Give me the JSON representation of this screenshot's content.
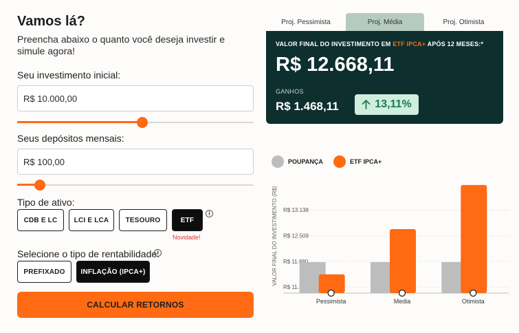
{
  "form": {
    "title": "Vamos lá?",
    "subtitle": "Preencha abaixo o quanto você deseja investir e simule agora!",
    "initial": {
      "label": "Seu investimento inicial:",
      "value": "R$ 10.000,00",
      "slider_fraction": 0.53
    },
    "monthly": {
      "label": "Seus depósitos mensais:",
      "value": "R$ 100,00",
      "slider_fraction": 0.095
    },
    "asset_type": {
      "label": "Tipo de ativo:",
      "options": [
        "CDB E LC",
        "LCI E LCA",
        "TESOURO",
        "ETF"
      ],
      "selected": "ETF",
      "new_tag": "Novidade!",
      "info_icon": "info-icon"
    },
    "rentabilidade": {
      "label": "Selecione o tipo de rentabilidade:",
      "options": [
        "PREFIXADO",
        "INFLAÇÃO (IPCA+)"
      ],
      "selected": "INFLAÇÃO (IPCA+)",
      "info_icon": "info-icon"
    },
    "calculate_label": "CALCULAR RETORNOS"
  },
  "results": {
    "tabs": [
      "Proj. Pessimista",
      "Proj. Média",
      "Proj. Otimista"
    ],
    "active_tab": "Proj. Média",
    "caption_prefix": "VALOR FINAL DO INVESTIMENTO EM ",
    "caption_highlight": "ETF IPCA+",
    "caption_suffix": " APÓS 12 MESES:*",
    "final_value": "R$ 12.668,11",
    "gains_label": "GANHOS",
    "gains_value": "R$ 1.468,11",
    "gains_percent": "13,11%",
    "gains_icon": "arrow-up-icon"
  },
  "colors": {
    "accent": "#ff6a13",
    "card_bg": "#0d2f2e",
    "tab_active": "#b6cbc0",
    "poupanca": "#bdbdbd",
    "badge_bg": "#cfeedd",
    "badge_text": "#1a7c4e"
  },
  "chart_data": {
    "type": "bar",
    "ylabel": "VALOR FINAL DO INVESTIMENTO (R$)",
    "categories": [
      "Pessimista",
      "Media",
      "Otimista"
    ],
    "yticks": [
      "R$ 11.250",
      "R$ 11.880",
      "R$ 12.509",
      "R$ 13.138"
    ],
    "ytick_values": [
      11250,
      11880,
      12509,
      13138
    ],
    "ylim": [
      11100,
      13900
    ],
    "grid": true,
    "legend_position": "top-left",
    "series": [
      {
        "name": "POUPANÇA",
        "color": "#bdbdbd",
        "values": [
          11860,
          11860,
          11860
        ]
      },
      {
        "name": "ETF IPCA+",
        "color": "#ff6a13",
        "values": [
          11560,
          12668,
          13750
        ]
      }
    ]
  }
}
